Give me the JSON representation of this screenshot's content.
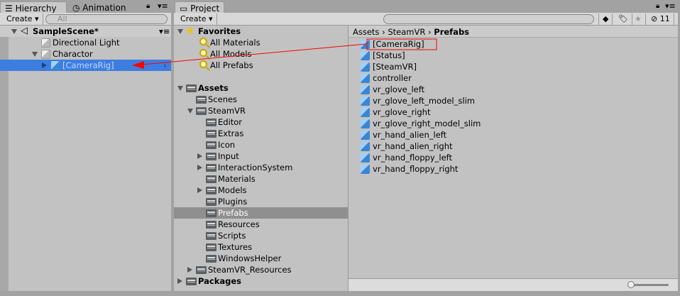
{
  "hierarchy": {
    "tabs": [
      {
        "label": "Hierarchy",
        "icon": "list-icon"
      },
      {
        "label": "Animation",
        "icon": "clock-icon"
      }
    ],
    "create_label": "Create",
    "search_placeholder": "All",
    "scene": "SampleScene*",
    "items": [
      {
        "label": "Directional Light",
        "depth": 1,
        "state": "none",
        "selected": false
      },
      {
        "label": "Charactor",
        "depth": 1,
        "state": "expanded",
        "selected": false
      },
      {
        "label": "[CameraRig]",
        "depth": 2,
        "state": "collapsed",
        "selected": true
      }
    ]
  },
  "project": {
    "tab": "Project",
    "create_label": "Create",
    "hidden_count": "11",
    "tree": [
      {
        "label": "Favorites",
        "depth": 0,
        "state": "expanded",
        "icon": "star",
        "bold": true
      },
      {
        "label": "All Materials",
        "depth": 1,
        "state": "none",
        "icon": "search"
      },
      {
        "label": "All Models",
        "depth": 1,
        "state": "none",
        "icon": "search"
      },
      {
        "label": "All Prefabs",
        "depth": 1,
        "state": "none",
        "icon": "search"
      },
      {
        "label": "",
        "depth": 0,
        "state": "none",
        "icon": "none"
      },
      {
        "label": "Assets",
        "depth": 0,
        "state": "expanded",
        "icon": "folder",
        "bold": true
      },
      {
        "label": "Scenes",
        "depth": 1,
        "state": "none",
        "icon": "folder"
      },
      {
        "label": "SteamVR",
        "depth": 1,
        "state": "expanded",
        "icon": "folder"
      },
      {
        "label": "Editor",
        "depth": 2,
        "state": "none",
        "icon": "folder"
      },
      {
        "label": "Extras",
        "depth": 2,
        "state": "none",
        "icon": "folder"
      },
      {
        "label": "Icon",
        "depth": 2,
        "state": "none",
        "icon": "folder"
      },
      {
        "label": "Input",
        "depth": 2,
        "state": "collapsed",
        "icon": "folder"
      },
      {
        "label": "InteractionSystem",
        "depth": 2,
        "state": "collapsed",
        "icon": "folder"
      },
      {
        "label": "Materials",
        "depth": 2,
        "state": "none",
        "icon": "folder"
      },
      {
        "label": "Models",
        "depth": 2,
        "state": "collapsed",
        "icon": "folder"
      },
      {
        "label": "Plugins",
        "depth": 2,
        "state": "none",
        "icon": "folder"
      },
      {
        "label": "Prefabs",
        "depth": 2,
        "state": "none",
        "icon": "folder",
        "selected": true
      },
      {
        "label": "Resources",
        "depth": 2,
        "state": "none",
        "icon": "folder"
      },
      {
        "label": "Scripts",
        "depth": 2,
        "state": "none",
        "icon": "folder"
      },
      {
        "label": "Textures",
        "depth": 2,
        "state": "none",
        "icon": "folder"
      },
      {
        "label": "WindowsHelper",
        "depth": 2,
        "state": "none",
        "icon": "folder"
      },
      {
        "label": "SteamVR_Resources",
        "depth": 1,
        "state": "collapsed",
        "icon": "folder"
      },
      {
        "label": "Packages",
        "depth": 0,
        "state": "collapsed",
        "icon": "folder",
        "bold": true
      }
    ],
    "breadcrumb": [
      "Assets",
      "SteamVR",
      "Prefabs"
    ],
    "assets": [
      "[CameraRig]",
      "[Status]",
      "[SteamVR]",
      "controller",
      "vr_glove_left",
      "vr_glove_left_model_slim",
      "vr_glove_right",
      "vr_glove_right_model_slim",
      "vr_hand_alien_left",
      "vr_hand_alien_right",
      "vr_hand_floppy_left",
      "vr_hand_floppy_right"
    ],
    "icon_size_fraction": 0
  },
  "colors": {
    "selection": "#3e7de0",
    "selection_gray": "#8f8f8f",
    "annotation": "#ff0000"
  }
}
